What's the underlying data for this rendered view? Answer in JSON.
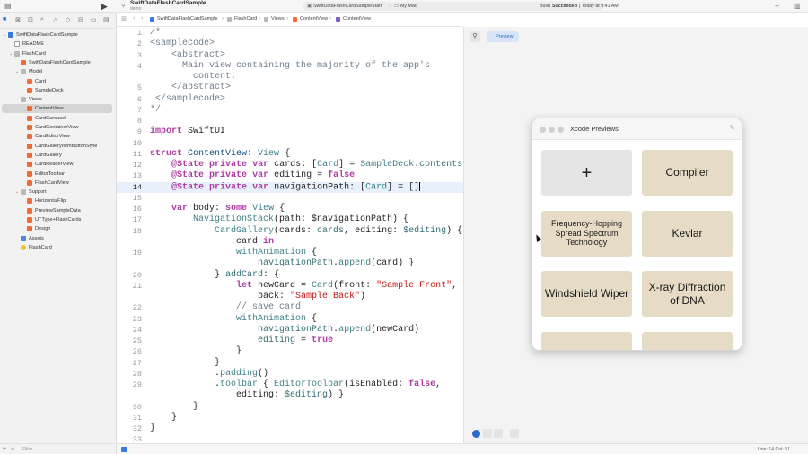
{
  "toolbar": {
    "project_name": "SwiftDataFlashCardSample",
    "branch": "demo",
    "scheme": "SwiftDataFlashCardSampleStart",
    "destination": "My Mac",
    "build_status_prefix": "Build",
    "build_status": "Succeeded",
    "build_time": "| Today at 9:41 AM"
  },
  "navigator": {
    "filter_placeholder": "Filter",
    "tree": [
      {
        "label": "SwiftDataFlashCardSample",
        "icon": "project-icon",
        "depth": 0,
        "disclosure": "open"
      },
      {
        "label": "README",
        "icon": "document-icon",
        "depth": 1
      },
      {
        "label": "FlashCard",
        "icon": "folder-icon",
        "depth": 1,
        "disclosure": "open"
      },
      {
        "label": "SwiftDataFlashCardSample",
        "icon": "swift-file-icon",
        "depth": 2
      },
      {
        "label": "Model",
        "icon": "folder-icon",
        "depth": 2,
        "disclosure": "open"
      },
      {
        "label": "Card",
        "icon": "swift-file-icon",
        "depth": 3
      },
      {
        "label": "SampleDeck",
        "icon": "swift-file-icon",
        "depth": 3
      },
      {
        "label": "Views",
        "icon": "folder-icon",
        "depth": 2,
        "disclosure": "open"
      },
      {
        "label": "ContentView",
        "icon": "swift-file-icon",
        "depth": 3,
        "selected": true
      },
      {
        "label": "CardCarousel",
        "icon": "swift-file-icon",
        "depth": 3
      },
      {
        "label": "CardContainerView",
        "icon": "swift-file-icon",
        "depth": 3
      },
      {
        "label": "CardEditorView",
        "icon": "swift-file-icon",
        "depth": 3
      },
      {
        "label": "CardGalleryItemButtonStyle",
        "icon": "swift-file-icon",
        "depth": 3
      },
      {
        "label": "CardGallery",
        "icon": "swift-file-icon",
        "depth": 3
      },
      {
        "label": "CardReaderView",
        "icon": "swift-file-icon",
        "depth": 3
      },
      {
        "label": "EditorToolbar",
        "icon": "swift-file-icon",
        "depth": 3
      },
      {
        "label": "FlashCardView",
        "icon": "swift-file-icon",
        "depth": 3
      },
      {
        "label": "Support",
        "icon": "folder-icon",
        "depth": 2,
        "disclosure": "open"
      },
      {
        "label": "HorizontalFlip",
        "icon": "swift-file-icon",
        "depth": 3
      },
      {
        "label": "PreviewSampleData",
        "icon": "swift-file-icon",
        "depth": 3
      },
      {
        "label": "UTType+FlashCards",
        "icon": "swift-file-icon",
        "depth": 3
      },
      {
        "label": "Design",
        "icon": "swift-file-icon",
        "depth": 3
      },
      {
        "label": "Assets",
        "icon": "assets-icon",
        "depth": 2
      },
      {
        "label": "FlashCard",
        "icon": "flashcard-icon",
        "depth": 2
      }
    ]
  },
  "jumpbar": {
    "crumbs": [
      "SwiftDataFlashCardSample",
      "FlashCard",
      "Views",
      "ContentView",
      "ContentView"
    ]
  },
  "editor": {
    "current_line": 14,
    "lines": [
      {
        "n": "1",
        "tokens": [
          {
            "t": "/*",
            "c": "c"
          }
        ]
      },
      {
        "n": "2",
        "tokens": [
          {
            "t": "<samplecode>",
            "c": "c"
          }
        ]
      },
      {
        "n": "3",
        "tokens": [
          {
            "t": "    <abstract>",
            "c": "c"
          }
        ]
      },
      {
        "n": "4",
        "tokens": [
          {
            "t": "      Main view containing the majority of the app's",
            "c": "c"
          }
        ]
      },
      {
        "n": "",
        "tokens": [
          {
            "t": "        content.",
            "c": "c"
          }
        ]
      },
      {
        "n": "5",
        "tokens": [
          {
            "t": "    </abstract>",
            "c": "c"
          }
        ]
      },
      {
        "n": "6",
        "tokens": [
          {
            "t": " </samplecode>",
            "c": "c"
          }
        ]
      },
      {
        "n": "7",
        "tokens": [
          {
            "t": "*/",
            "c": "c"
          }
        ]
      },
      {
        "n": "8",
        "tokens": []
      },
      {
        "n": "9",
        "tokens": [
          {
            "t": "import",
            "c": "k"
          },
          {
            "t": " SwiftUI",
            "c": ""
          }
        ]
      },
      {
        "n": "10",
        "tokens": []
      },
      {
        "n": "11",
        "tokens": [
          {
            "t": "struct",
            "c": "k"
          },
          {
            "t": " ContentView",
            "c": "t"
          },
          {
            "t": ": ",
            "c": ""
          },
          {
            "t": "View",
            "c": "p"
          },
          {
            "t": " {",
            "c": ""
          }
        ]
      },
      {
        "n": "12",
        "tokens": [
          {
            "t": "    @State",
            "c": "k"
          },
          {
            "t": " ",
            "c": ""
          },
          {
            "t": "private",
            "c": "k"
          },
          {
            "t": " ",
            "c": ""
          },
          {
            "t": "var",
            "c": "k"
          },
          {
            "t": " cards: [",
            "c": ""
          },
          {
            "t": "Card",
            "c": "p"
          },
          {
            "t": "] = ",
            "c": ""
          },
          {
            "t": "SampleDeck",
            "c": "p"
          },
          {
            "t": ".",
            "c": ""
          },
          {
            "t": "contents",
            "c": "f"
          }
        ]
      },
      {
        "n": "13",
        "tokens": [
          {
            "t": "    @State",
            "c": "k"
          },
          {
            "t": " ",
            "c": ""
          },
          {
            "t": "private",
            "c": "k"
          },
          {
            "t": " ",
            "c": ""
          },
          {
            "t": "var",
            "c": "k"
          },
          {
            "t": " editing = ",
            "c": ""
          },
          {
            "t": "false",
            "c": "k"
          }
        ]
      },
      {
        "n": "14",
        "tokens": [
          {
            "t": "    @State",
            "c": "k"
          },
          {
            "t": " ",
            "c": ""
          },
          {
            "t": "private",
            "c": "k"
          },
          {
            "t": " ",
            "c": ""
          },
          {
            "t": "var",
            "c": "k"
          },
          {
            "t": " navigationPath: [",
            "c": ""
          },
          {
            "t": "Card",
            "c": "p"
          },
          {
            "t": "] = []",
            "c": ""
          }
        ],
        "caret": true
      },
      {
        "n": "15",
        "tokens": []
      },
      {
        "n": "16",
        "tokens": [
          {
            "t": "    ",
            "c": ""
          },
          {
            "t": "var",
            "c": "k"
          },
          {
            "t": " body: ",
            "c": ""
          },
          {
            "t": "some",
            "c": "k"
          },
          {
            "t": " ",
            "c": ""
          },
          {
            "t": "View",
            "c": "p"
          },
          {
            "t": " {",
            "c": ""
          }
        ]
      },
      {
        "n": "17",
        "tokens": [
          {
            "t": "        ",
            "c": ""
          },
          {
            "t": "NavigationStack",
            "c": "p"
          },
          {
            "t": "(path: $navigationPath) {",
            "c": ""
          }
        ]
      },
      {
        "n": "18",
        "tokens": [
          {
            "t": "            ",
            "c": ""
          },
          {
            "t": "CardGallery",
            "c": "p"
          },
          {
            "t": "(cards: ",
            "c": ""
          },
          {
            "t": "cards",
            "c": "f"
          },
          {
            "t": ", editing: ",
            "c": ""
          },
          {
            "t": "$editing",
            "c": "f"
          },
          {
            "t": ") {",
            "c": ""
          }
        ]
      },
      {
        "n": "",
        "tokens": [
          {
            "t": "                card ",
            "c": ""
          },
          {
            "t": "in",
            "c": "k"
          }
        ]
      },
      {
        "n": "19",
        "tokens": [
          {
            "t": "                ",
            "c": ""
          },
          {
            "t": "withAnimation",
            "c": "p"
          },
          {
            "t": " {",
            "c": ""
          }
        ]
      },
      {
        "n": "",
        "tokens": [
          {
            "t": "                    ",
            "c": ""
          },
          {
            "t": "navigationPath",
            "c": "f"
          },
          {
            "t": ".",
            "c": ""
          },
          {
            "t": "append",
            "c": "p"
          },
          {
            "t": "(card) }",
            "c": ""
          }
        ]
      },
      {
        "n": "20",
        "tokens": [
          {
            "t": "            } ",
            "c": ""
          },
          {
            "t": "addCard",
            "c": "f"
          },
          {
            "t": ": {",
            "c": ""
          }
        ]
      },
      {
        "n": "21",
        "tokens": [
          {
            "t": "                ",
            "c": ""
          },
          {
            "t": "let",
            "c": "k"
          },
          {
            "t": " newCard = ",
            "c": ""
          },
          {
            "t": "Card",
            "c": "p"
          },
          {
            "t": "(front: ",
            "c": ""
          },
          {
            "t": "\"Sample Front\"",
            "c": "s"
          },
          {
            "t": ",",
            "c": ""
          }
        ]
      },
      {
        "n": "",
        "tokens": [
          {
            "t": "                    back: ",
            "c": ""
          },
          {
            "t": "\"Sample Back\"",
            "c": "s"
          },
          {
            "t": ")",
            "c": ""
          }
        ]
      },
      {
        "n": "22",
        "tokens": [
          {
            "t": "                // save card",
            "c": "c"
          }
        ]
      },
      {
        "n": "23",
        "tokens": [
          {
            "t": "                ",
            "c": ""
          },
          {
            "t": "withAnimation",
            "c": "p"
          },
          {
            "t": " {",
            "c": ""
          }
        ]
      },
      {
        "n": "24",
        "tokens": [
          {
            "t": "                    ",
            "c": ""
          },
          {
            "t": "navigationPath",
            "c": "f"
          },
          {
            "t": ".",
            "c": ""
          },
          {
            "t": "append",
            "c": "p"
          },
          {
            "t": "(newCard)",
            "c": ""
          }
        ]
      },
      {
        "n": "25",
        "tokens": [
          {
            "t": "                    ",
            "c": ""
          },
          {
            "t": "editing",
            "c": "f"
          },
          {
            "t": " = ",
            "c": ""
          },
          {
            "t": "true",
            "c": "k"
          }
        ]
      },
      {
        "n": "26",
        "tokens": [
          {
            "t": "                }",
            "c": ""
          }
        ]
      },
      {
        "n": "27",
        "tokens": [
          {
            "t": "            }",
            "c": ""
          }
        ]
      },
      {
        "n": "28",
        "tokens": [
          {
            "t": "            .",
            "c": ""
          },
          {
            "t": "padding",
            "c": "p"
          },
          {
            "t": "()",
            "c": ""
          }
        ]
      },
      {
        "n": "29",
        "tokens": [
          {
            "t": "            .",
            "c": ""
          },
          {
            "t": "toolbar",
            "c": "p"
          },
          {
            "t": " { ",
            "c": ""
          },
          {
            "t": "EditorToolbar",
            "c": "p"
          },
          {
            "t": "(isEnabled: ",
            "c": ""
          },
          {
            "t": "false",
            "c": "k"
          },
          {
            "t": ",",
            "c": ""
          }
        ]
      },
      {
        "n": "",
        "tokens": [
          {
            "t": "                editing: ",
            "c": ""
          },
          {
            "t": "$editing",
            "c": "f"
          },
          {
            "t": ") }",
            "c": ""
          }
        ]
      },
      {
        "n": "30",
        "tokens": [
          {
            "t": "        }",
            "c": ""
          }
        ]
      },
      {
        "n": "31",
        "tokens": [
          {
            "t": "    }",
            "c": ""
          }
        ]
      },
      {
        "n": "32",
        "tokens": [
          {
            "t": "}",
            "c": ""
          }
        ]
      },
      {
        "n": "33",
        "tokens": []
      }
    ]
  },
  "canvas": {
    "preview_label": "Preview",
    "window_title": "Xcode Previews",
    "cards": [
      {
        "text": "+",
        "kind": "add"
      },
      {
        "text": "Compiler",
        "kind": "l"
      },
      {
        "text": "Frequency-Hopping Spread Spectrum Technology",
        "kind": "s"
      },
      {
        "text": "Kevlar",
        "kind": "l"
      },
      {
        "text": "Windshield Wiper",
        "kind": "l"
      },
      {
        "text": "X-ray Diffraction of DNA",
        "kind": "l"
      },
      {
        "text": "",
        "kind": "l"
      },
      {
        "text": "",
        "kind": "l"
      }
    ]
  },
  "statusbar": {
    "position": "Line: 14  Col: 51"
  },
  "colors": {
    "keyword": "#ad3da4",
    "type": "#0b4f79",
    "string": "#c41a16",
    "comment": "#707f8c",
    "card_background": "#e6dcc5",
    "accent": "#2f6bc9"
  }
}
